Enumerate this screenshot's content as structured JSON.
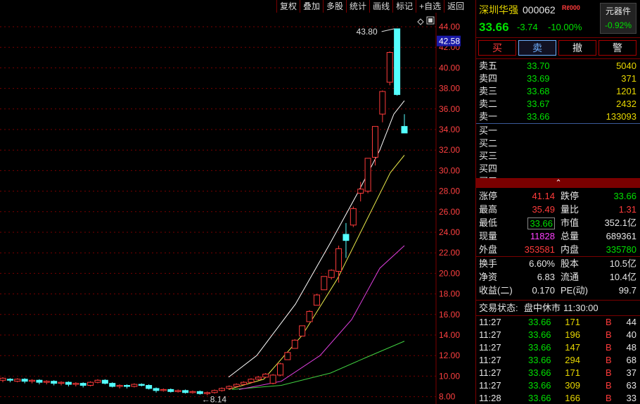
{
  "toolbar": {
    "items": [
      "复权",
      "叠加",
      "多股",
      "统计",
      "画线",
      "标记",
      "+自选",
      "返回"
    ]
  },
  "chart": {
    "price_labels": [
      "44.00",
      "42.00",
      "40.00",
      "38.00",
      "36.00",
      "34.00",
      "32.00",
      "30.00",
      "28.00",
      "26.00",
      "24.00",
      "22.00",
      "20.00",
      "18.00",
      "16.00",
      "14.00",
      "12.00",
      "10.00",
      "8.00"
    ],
    "current_price_tag": "42.58",
    "high_annotation": "43.80",
    "low_annotation": "8.14",
    "candles": [
      {
        "o": 9.6,
        "c": 9.8,
        "h": 9.9,
        "l": 9.4
      },
      {
        "o": 9.7,
        "c": 9.6,
        "h": 9.8,
        "l": 9.4
      },
      {
        "o": 9.5,
        "c": 9.7,
        "h": 9.8,
        "l": 9.4
      },
      {
        "o": 9.7,
        "c": 9.5,
        "h": 9.8,
        "l": 9.3
      },
      {
        "o": 9.5,
        "c": 9.6,
        "h": 9.7,
        "l": 9.3
      },
      {
        "o": 9.6,
        "c": 9.4,
        "h": 9.7,
        "l": 9.2
      },
      {
        "o": 9.4,
        "c": 9.5,
        "h": 9.6,
        "l": 9.2
      },
      {
        "o": 9.5,
        "c": 9.3,
        "h": 9.6,
        "l": 9.1
      },
      {
        "o": 9.3,
        "c": 9.4,
        "h": 9.5,
        "l": 9.1
      },
      {
        "o": 9.4,
        "c": 9.2,
        "h": 9.5,
        "l": 9.0
      },
      {
        "o": 9.2,
        "c": 9.3,
        "h": 9.4,
        "l": 9.0
      },
      {
        "o": 9.3,
        "c": 9.1,
        "h": 9.4,
        "l": 8.9
      },
      {
        "o": 9.1,
        "c": 9.4,
        "h": 9.5,
        "l": 9.0
      },
      {
        "o": 9.4,
        "c": 9.6,
        "h": 9.7,
        "l": 9.3
      },
      {
        "o": 9.6,
        "c": 9.3,
        "h": 9.7,
        "l": 9.2
      },
      {
        "o": 9.3,
        "c": 9.0,
        "h": 9.4,
        "l": 8.9
      },
      {
        "o": 9.0,
        "c": 9.1,
        "h": 9.2,
        "l": 8.8
      },
      {
        "o": 9.1,
        "c": 9.0,
        "h": 9.2,
        "l": 8.8
      },
      {
        "o": 9.0,
        "c": 9.2,
        "h": 9.3,
        "l": 8.9
      },
      {
        "o": 9.2,
        "c": 9.1,
        "h": 9.3,
        "l": 9.0
      },
      {
        "o": 9.1,
        "c": 8.8,
        "h": 9.2,
        "l": 8.7
      },
      {
        "o": 8.8,
        "c": 8.6,
        "h": 8.9,
        "l": 8.4
      },
      {
        "o": 8.6,
        "c": 8.7,
        "h": 8.8,
        "l": 8.5
      },
      {
        "o": 8.7,
        "c": 8.5,
        "h": 8.8,
        "l": 8.4
      },
      {
        "o": 8.5,
        "c": 8.6,
        "h": 8.7,
        "l": 8.4
      },
      {
        "o": 8.6,
        "c": 8.4,
        "h": 8.7,
        "l": 8.3
      },
      {
        "o": 8.4,
        "c": 8.5,
        "h": 8.6,
        "l": 8.3
      },
      {
        "o": 8.5,
        "c": 8.3,
        "h": 8.6,
        "l": 8.2
      },
      {
        "o": 8.3,
        "c": 8.4,
        "h": 8.5,
        "l": 8.14
      },
      {
        "o": 8.4,
        "c": 8.6,
        "h": 8.7,
        "l": 8.3
      },
      {
        "o": 8.6,
        "c": 8.8,
        "h": 8.9,
        "l": 8.5
      },
      {
        "o": 8.8,
        "c": 9.0,
        "h": 9.1,
        "l": 8.7
      },
      {
        "o": 9.0,
        "c": 9.2,
        "h": 9.3,
        "l": 8.9
      },
      {
        "o": 9.2,
        "c": 9.4,
        "h": 9.5,
        "l": 9.1
      },
      {
        "o": 9.4,
        "c": 9.7,
        "h": 9.8,
        "l": 9.3
      },
      {
        "o": 9.7,
        "c": 9.9,
        "h": 10.0,
        "l": 9.6
      },
      {
        "o": 9.9,
        "c": 10.2,
        "h": 10.3,
        "l": 9.8
      },
      {
        "o": 9.3,
        "c": 10.1,
        "h": 10.2,
        "l": 9.2
      },
      {
        "o": 10.1,
        "c": 11.2,
        "h": 11.3,
        "l": 10.0
      },
      {
        "o": 11.6,
        "c": 12.3,
        "h": 12.4,
        "l": 11.6
      },
      {
        "o": 12.7,
        "c": 13.5,
        "h": 13.6,
        "l": 12.7
      },
      {
        "o": 13.9,
        "c": 14.9,
        "h": 14.9,
        "l": 13.9
      },
      {
        "o": 15.3,
        "c": 16.3,
        "h": 16.4,
        "l": 15.3
      },
      {
        "o": 16.9,
        "c": 17.9,
        "h": 18.0,
        "l": 16.9
      },
      {
        "o": 18.4,
        "c": 19.7,
        "h": 19.7,
        "l": 18.4
      },
      {
        "o": 19.6,
        "c": 20.3,
        "h": 20.4,
        "l": 19.4
      },
      {
        "o": 20.2,
        "c": 22.4,
        "h": 22.7,
        "l": 19.1
      },
      {
        "o": 23.8,
        "c": 23.2,
        "h": 24.9,
        "l": 21.5
      },
      {
        "o": 24.7,
        "c": 26.3,
        "h": 26.5,
        "l": 24.5
      },
      {
        "o": 27.8,
        "c": 28.2,
        "h": 28.9,
        "l": 27.0
      },
      {
        "o": 28.0,
        "c": 31.2,
        "h": 31.2,
        "l": 27.8
      },
      {
        "o": 31.3,
        "c": 34.3,
        "h": 34.3,
        "l": 30.5
      },
      {
        "o": 35.5,
        "c": 37.7,
        "h": 37.8,
        "l": 34.7
      },
      {
        "o": 38.6,
        "c": 41.5,
        "h": 41.6,
        "l": 38.3
      },
      {
        "o": 43.8,
        "c": 37.4,
        "h": 43.8,
        "l": 37.3
      },
      {
        "o": 34.3,
        "c": 33.66,
        "h": 35.49,
        "l": 33.66
      }
    ],
    "ma_white": [
      [
        325,
        9.9
      ],
      [
        365,
        12
      ],
      [
        420,
        17
      ],
      [
        470,
        23
      ],
      [
        510,
        28
      ],
      [
        540,
        32
      ],
      [
        560,
        35.5
      ],
      [
        575,
        36.8
      ]
    ],
    "ma_yellow": [
      [
        325,
        8.7
      ],
      [
        375,
        9.7
      ],
      [
        430,
        14
      ],
      [
        480,
        19.5
      ],
      [
        520,
        25
      ],
      [
        555,
        29.8
      ],
      [
        575,
        31.5
      ]
    ],
    "ma_magenta": [
      [
        340,
        8.7
      ],
      [
        400,
        9.5
      ],
      [
        455,
        12
      ],
      [
        500,
        15.5
      ],
      [
        540,
        20.5
      ],
      [
        575,
        22.7
      ]
    ],
    "ma_green": [
      [
        330,
        8.7
      ],
      [
        400,
        9.1
      ],
      [
        470,
        10.3
      ],
      [
        520,
        11.8
      ],
      [
        575,
        13.4
      ]
    ]
  },
  "stock": {
    "name": "深圳华强",
    "code": "000062",
    "badge": "R",
    "badge_text": "ℓ000",
    "price": "33.66",
    "change": "-3.74",
    "pct": "-10.00%",
    "sector": "元器件",
    "sector_pct": "-0.92%"
  },
  "trade": {
    "buy": "买",
    "sell": "卖",
    "cancel": "撤",
    "alert": "警"
  },
  "asks": [
    {
      "label": "卖五",
      "price": "33.70",
      "vol": "5040"
    },
    {
      "label": "卖四",
      "price": "33.69",
      "vol": "371"
    },
    {
      "label": "卖三",
      "price": "33.68",
      "vol": "1201"
    },
    {
      "label": "卖二",
      "price": "33.67",
      "vol": "2432"
    },
    {
      "label": "卖一",
      "price": "33.66",
      "vol": "133093"
    }
  ],
  "bids": [
    {
      "label": "买一"
    },
    {
      "label": "买二"
    },
    {
      "label": "买三"
    },
    {
      "label": "买四"
    },
    {
      "label": "买五"
    }
  ],
  "expand_icon": "⌃",
  "stats": [
    [
      {
        "l": "涨停",
        "v": "41.14",
        "c": "red"
      },
      {
        "l": "跌停",
        "v": "33.66",
        "c": "green"
      }
    ],
    [
      {
        "l": "最高",
        "v": "35.49",
        "c": "red"
      },
      {
        "l": "量比",
        "v": "1.31",
        "c": "red"
      }
    ],
    [
      {
        "l": "最低",
        "v": "33.66",
        "c": "green"
      },
      {
        "l": "市值",
        "v": "352.1亿",
        "c": "white"
      }
    ],
    [
      {
        "l": "现量",
        "v": "11828",
        "c": "magenta"
      },
      {
        "l": "总量",
        "v": "689361",
        "c": "white"
      }
    ],
    [
      {
        "l": "外盘",
        "v": "353581",
        "c": "red"
      },
      {
        "l": "内盘",
        "v": "335780",
        "c": "green"
      }
    ],
    [
      {
        "l": "换手",
        "v": "6.60%",
        "c": "white"
      },
      {
        "l": "股本",
        "v": "10.5亿",
        "c": "white"
      }
    ],
    [
      {
        "l": "净资",
        "v": "6.83",
        "c": "white"
      },
      {
        "l": "流通",
        "v": "10.4亿",
        "c": "white"
      }
    ],
    [
      {
        "l": "收益(二)",
        "v": "0.170",
        "c": "white"
      },
      {
        "l": "PE(动)",
        "v": "99.7",
        "c": "white"
      }
    ]
  ],
  "status": {
    "label": "交易状态:",
    "value": "盘中休市",
    "time": "11:30:00"
  },
  "ticks": [
    {
      "t": "11:27",
      "p": "33.66",
      "v": "171",
      "s": "B",
      "n": "44"
    },
    {
      "t": "11:27",
      "p": "33.66",
      "v": "196",
      "s": "B",
      "n": "40"
    },
    {
      "t": "11:27",
      "p": "33.66",
      "v": "147",
      "s": "B",
      "n": "48"
    },
    {
      "t": "11:27",
      "p": "33.66",
      "v": "294",
      "s": "B",
      "n": "68"
    },
    {
      "t": "11:27",
      "p": "33.66",
      "v": "171",
      "s": "B",
      "n": "37"
    },
    {
      "t": "11:27",
      "p": "33.66",
      "v": "309",
      "s": "B",
      "n": "63"
    },
    {
      "t": "11:28",
      "p": "33.66",
      "v": "166",
      "s": "B",
      "n": "33"
    }
  ],
  "colors": {
    "up": "#ff3b3b",
    "down": "#54ffff",
    "grid": "#7a0000",
    "ma_white": "#ffffff",
    "ma_yellow": "#e8e84a",
    "ma_magenta": "#e040e0",
    "ma_green": "#40d040",
    "price_tag_bg": "#1a1aa8"
  }
}
